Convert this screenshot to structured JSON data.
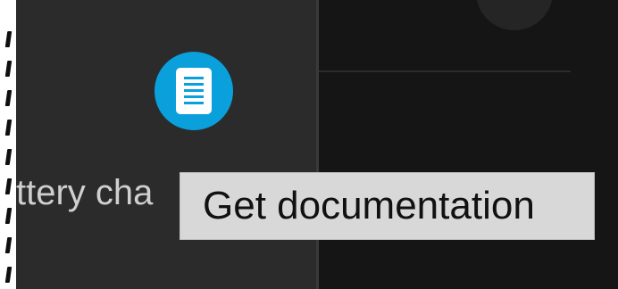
{
  "panels": {
    "left_label_partial": "ttery cha",
    "doc_icon": "document-icon"
  },
  "tooltip": {
    "text": "Get documentation"
  },
  "colors": {
    "left_panel": "#2b2b2b",
    "right_panel": "#151515",
    "doc_button": "#0aa0dc",
    "tooltip_bg": "#d8d8d8",
    "tooltip_text": "#111111"
  }
}
